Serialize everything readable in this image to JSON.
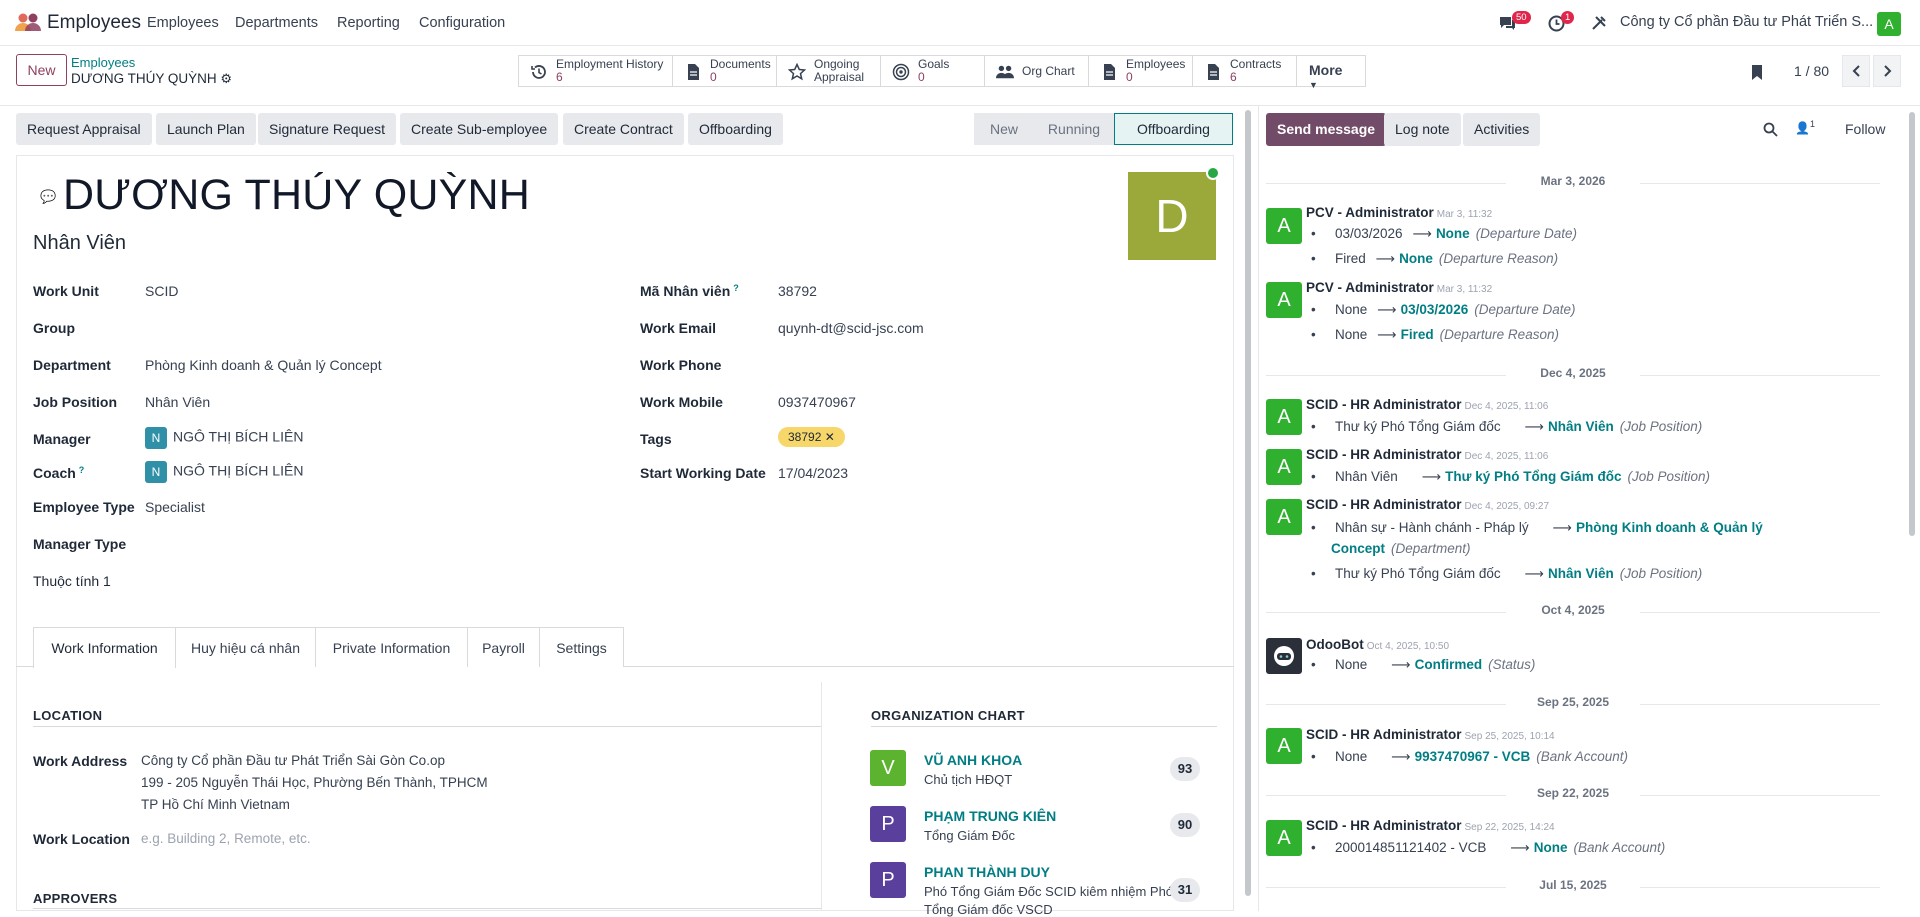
{
  "app": {
    "name": "Employees",
    "menu": [
      "Employees",
      "Departments",
      "Reporting",
      "Configuration"
    ],
    "chat_count": "50",
    "activity_count": "1",
    "company": "Công ty Cổ phần Đầu tư Phát Triển S...",
    "user_initial": "A"
  },
  "control": {
    "new_label": "New",
    "breadcrumb_parent": "Employees",
    "breadcrumb_current": "DƯƠNG THÚY QUỲNH",
    "pager": "1 / 80",
    "more_label": "More",
    "smart_buttons": [
      {
        "label": "Employment History",
        "value": "6",
        "icon": "history-icon"
      },
      {
        "label": "Documents",
        "value": "0",
        "icon": "document-icon"
      },
      {
        "label": "Ongoing",
        "label2": "Appraisal",
        "icon": "star-icon"
      },
      {
        "label": "Goals",
        "value": "0",
        "icon": "target-icon"
      },
      {
        "label": "Org Chart",
        "icon": "users-icon"
      },
      {
        "label": "Employees",
        "value": "0",
        "icon": "document-icon"
      },
      {
        "label": "Contracts",
        "value": "6",
        "icon": "document-icon"
      }
    ]
  },
  "actions": [
    "Request Appraisal",
    "Launch Plan",
    "Signature Request",
    "Create Sub-employee",
    "Create Contract",
    "Offboarding"
  ],
  "stages": [
    "New",
    "Running",
    "Offboarding"
  ],
  "employee": {
    "name": "DƯƠNG THÚY QUỲNH",
    "job_title": "Nhân Viên",
    "avatar_letter": "D"
  },
  "fields_left": [
    {
      "label": "Work Unit",
      "value": "SCID"
    },
    {
      "label": "Group",
      "value": ""
    },
    {
      "label": "Department",
      "value": "Phòng Kinh doanh & Quản lý Concept"
    },
    {
      "label": "Job Position",
      "value": "Nhân Viên"
    },
    {
      "label": "Manager",
      "value": "NGÔ THỊ BÍCH LIÊN",
      "badge": "N"
    },
    {
      "label": "Coach",
      "value": "NGÔ THỊ BÍCH LIÊN",
      "badge": "N",
      "help": "?"
    },
    {
      "label": "Employee Type",
      "value": "Specialist"
    },
    {
      "label": "Manager Type",
      "value": ""
    },
    {
      "label": "Thuộc tính 1",
      "value": ""
    }
  ],
  "fields_right": [
    {
      "label": "Mã Nhân viên",
      "value": "38792",
      "help": "?"
    },
    {
      "label": "Work Email",
      "value": "quynh-dt@scid-jsc.com"
    },
    {
      "label": "Work Phone",
      "value": ""
    },
    {
      "label": "Work Mobile",
      "value": "0937470967"
    },
    {
      "label": "Tags",
      "value": "38792"
    },
    {
      "label": "Start Working Date",
      "value": "17/04/2023"
    }
  ],
  "tabs": [
    "Work Information",
    "Huy hiệu cá nhân",
    "Private Information",
    "Payroll",
    "Settings"
  ],
  "location": {
    "heading": "LOCATION",
    "work_address_label": "Work Address",
    "address": [
      "Công ty Cổ phần Đầu tư Phát Triển Sài Gòn Co.op",
      "199 - 205 Nguyễn Thái Học, Phường Bến Thành, TPHCM",
      "TP Hồ Chí Minh Vietnam"
    ],
    "work_location_label": "Work Location",
    "work_location_placeholder": "e.g. Building 2, Remote, etc.",
    "approvers_heading": "APPROVERS"
  },
  "org_chart": {
    "heading": "ORGANIZATION CHART",
    "people": [
      {
        "letter": "V",
        "name": "VŨ ANH KHOA",
        "job": "Chủ tịch HĐQT",
        "count": "93",
        "color": "#5cb32f"
      },
      {
        "letter": "P",
        "name": "PHẠM TRUNG KIÊN",
        "job": "Tổng Giám Đốc",
        "count": "90",
        "color": "#5b3f9c"
      },
      {
        "letter": "P",
        "name": "PHAN THÀNH DUY",
        "job": "Phó Tổng Giám Đốc SCID kiêm nhiệm Phó",
        "job2": "Tổng Giám đốc VSCD",
        "count": "31",
        "color": "#5b3f9c"
      }
    ]
  },
  "chatter": {
    "send_message": "Send message",
    "log_note": "Log note",
    "activities": "Activities",
    "follow": "Follow",
    "followers": "1",
    "dates": [
      "Mar 3, 2026",
      "Dec 4, 2025",
      "Oct 4, 2025",
      "Sep 25, 2025",
      "Sep 22, 2025",
      "Jul 15, 2025"
    ],
    "messages": [
      {
        "author": "PCV - Administrator",
        "time": "Mar 3, 11:32",
        "lines": [
          {
            "old": "03/03/2026",
            "new": "None",
            "field": "(Departure Date)"
          },
          {
            "old": "Fired",
            "new": "None",
            "field": "(Departure Reason)"
          }
        ]
      },
      {
        "author": "PCV - Administrator",
        "time": "Mar 3, 11:32",
        "lines": [
          {
            "old": "None",
            "new": "03/03/2026",
            "field": "(Departure Date)"
          },
          {
            "old": "None",
            "new": "Fired",
            "field": "(Departure Reason)"
          }
        ]
      },
      {
        "author": "SCID - HR Administrator",
        "time": "Dec 4, 2025, 11:06",
        "lines": [
          {
            "old": "Thư ký Phó Tổng Giám đốc",
            "new": "Nhân Viên",
            "field": "(Job Position)"
          }
        ]
      },
      {
        "author": "SCID - HR Administrator",
        "time": "Dec 4, 2025, 11:06",
        "lines": [
          {
            "old": "Nhân Viên",
            "new": "Thư ký Phó Tổng Giám đốc",
            "field": "(Job Position)"
          }
        ]
      },
      {
        "author": "SCID - HR Administrator",
        "time": "Dec 4, 2025, 09:27",
        "lines": [
          {
            "old": "Nhân sự - Hành chánh - Pháp lý",
            "new": "Phòng Kinh doanh & Quản lý",
            "new2": "Concept",
            "field": "(Department)"
          },
          {
            "old": "Thư ký Phó Tổng Giám đốc",
            "new": "Nhân Viên",
            "field": "(Job Position)"
          }
        ]
      },
      {
        "author": "OdooBot",
        "time": "Oct 4, 2025, 10:50",
        "lines": [
          {
            "old": "None",
            "new": "Confirmed",
            "field": "(Status)"
          }
        ]
      },
      {
        "author": "SCID - HR Administrator",
        "time": "Sep 25, 2025, 10:14",
        "lines": [
          {
            "old": "None",
            "new": "9937470967 - VCB",
            "field": "(Bank Account)"
          }
        ]
      },
      {
        "author": "SCID - HR Administrator",
        "time": "Sep 22, 2025, 14:24",
        "lines": [
          {
            "old": "200014851121402 - VCB",
            "new": "None",
            "field": "(Bank Account)"
          }
        ]
      }
    ]
  }
}
